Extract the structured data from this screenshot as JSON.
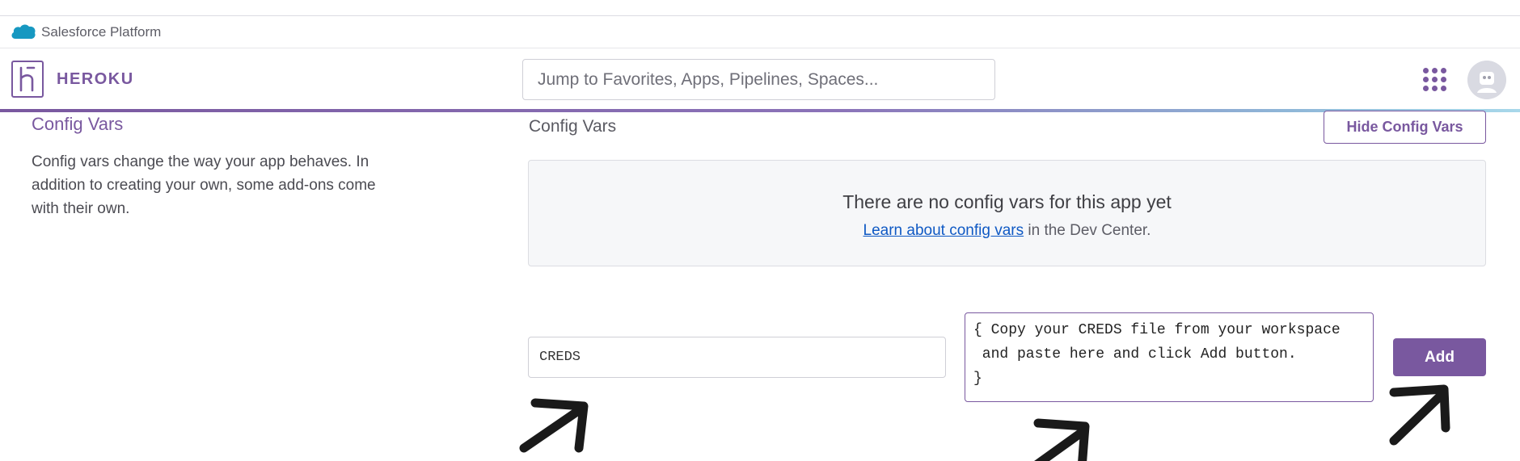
{
  "salesforce_bar": {
    "label": "Salesforce Platform",
    "icon": "salesforce-cloud-icon",
    "color": "#1798c1"
  },
  "header": {
    "brand": "HEROKU",
    "brand_color": "#79589f",
    "search_placeholder": "Jump to Favorites, Apps, Pipelines, Spaces...",
    "apps_icon": "apps-grid-icon",
    "avatar_icon": "user-avatar-icon"
  },
  "sidebar": {
    "title": "Config Vars",
    "description": "Config vars change the way your app behaves. In addition to creating your own, some add-ons come with their own."
  },
  "main": {
    "title": "Config Vars",
    "hide_button": "Hide Config Vars",
    "empty_state": {
      "heading": "There are no config vars for this app yet",
      "link_text": "Learn about config vars",
      "suffix": " in the Dev Center."
    },
    "key_input_value": "CREDS",
    "value_input_value": "{ Copy your CREDS file from your workspace\n and paste here and click Add button.\n}",
    "add_button": "Add"
  },
  "annotations": {
    "arrow_icon": "arrow-up-right-icon",
    "arrow_color": "#1a1a1a"
  }
}
